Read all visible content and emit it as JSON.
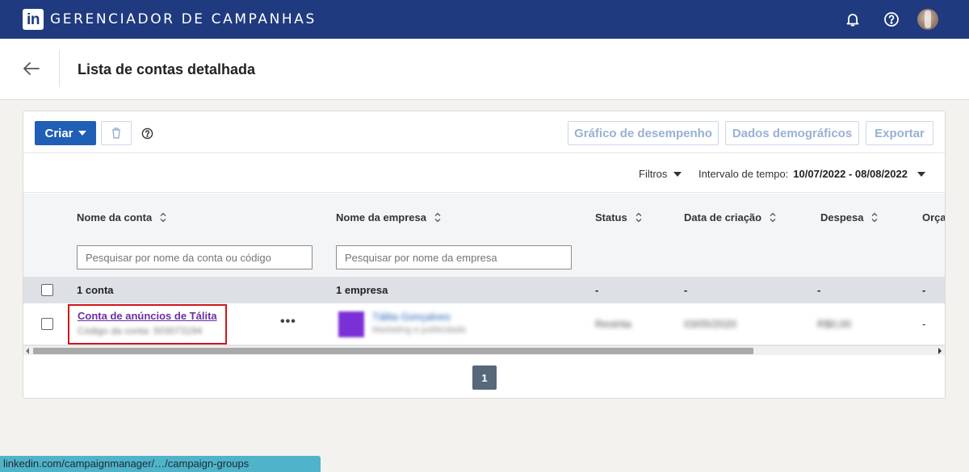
{
  "app": {
    "logo_text": "in",
    "title": "GERENCIADOR DE CAMPANHAS"
  },
  "header_icons": [
    "bell-icon",
    "help-icon",
    "avatar"
  ],
  "page": {
    "title": "Lista de contas detalhada"
  },
  "toolbar": {
    "create_label": "Criar",
    "performance_label": "Gráfico de desempenho",
    "demographics_label": "Dados demográficos",
    "export_label": "Exportar"
  },
  "filterbar": {
    "filters_label": "Filtros",
    "interval_label": "Intervalo de tempo:",
    "interval_value": "10/07/2022 - 08/08/2022"
  },
  "table": {
    "columns": [
      {
        "label": "Nome da conta"
      },
      {
        "label": "Nome da empresa"
      },
      {
        "label": "Status"
      },
      {
        "label": "Data de criação"
      },
      {
        "label": "Despesa"
      },
      {
        "label": "Orça"
      }
    ],
    "search_account_placeholder": "Pesquisar por nome da conta ou código",
    "search_company_placeholder": "Pesquisar por nome da empresa",
    "summary": {
      "accounts": "1 conta",
      "companies": "1 empresa",
      "status": "-",
      "created": "-",
      "spend": "-",
      "budget": "-"
    },
    "rows": [
      {
        "account_name": "Conta de anúncios de Tálita",
        "account_code": "Código da conta: 503073194",
        "more_label": "•••",
        "company_name": "Tálita Gonçalves",
        "company_sub": "Marketing e publicidade",
        "status": "Restrita",
        "created": "03/05/2020",
        "spend": "R$0,00",
        "budget": "-"
      }
    ]
  },
  "pagination": {
    "current_page": "1"
  },
  "status_bar": {
    "url": "linkedin.com/campaignmanager/…/campaign-groups"
  },
  "colors": {
    "topbar": "#1f3a7f",
    "primary_button": "#1f5fb5",
    "link_visited": "#6a2ea8",
    "highlight_border": "#d0161c",
    "pager": "#56687a"
  }
}
